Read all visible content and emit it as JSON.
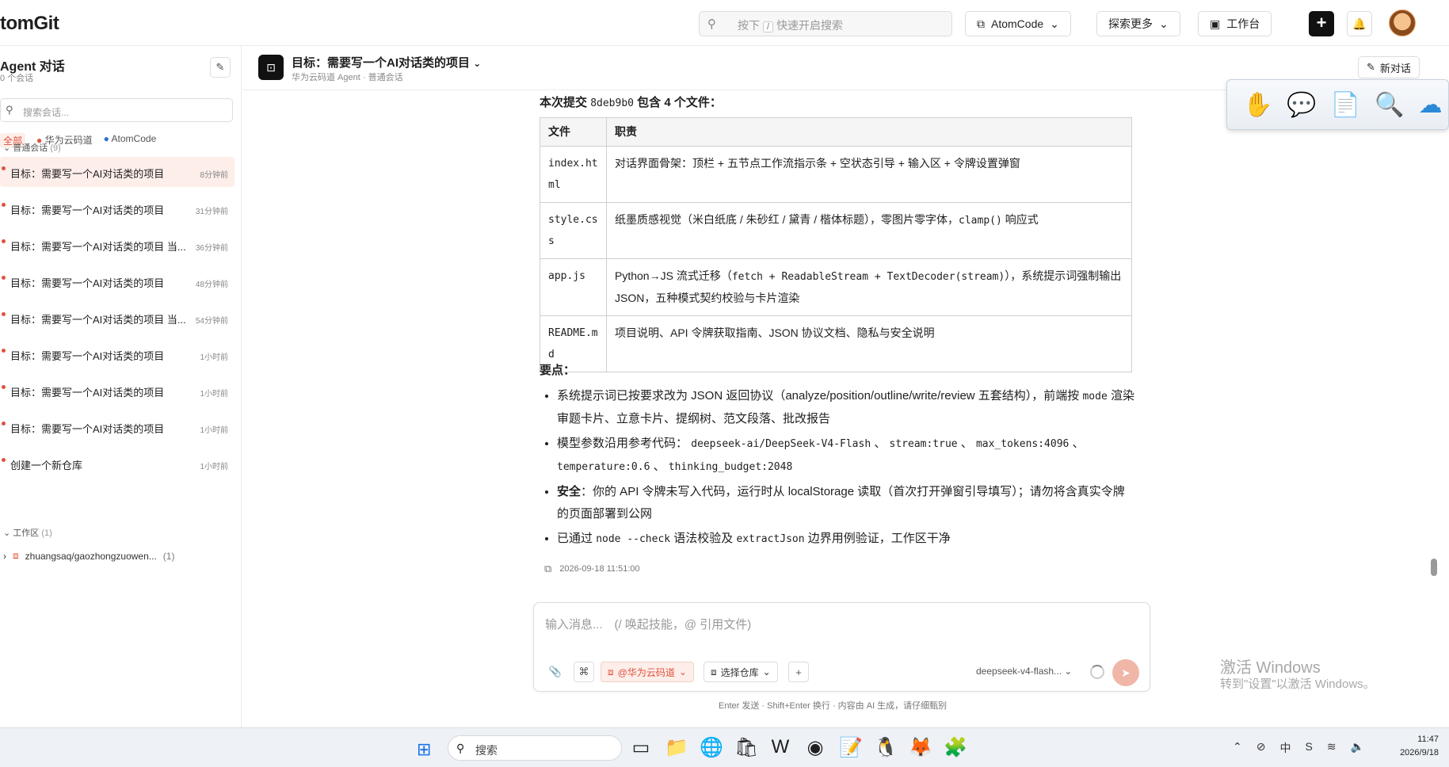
{
  "header": {
    "logo": "tomGit",
    "search_placeholder": "按下",
    "search_key": "/",
    "search_suffix": "快速开启搜索",
    "atomcode_label": "AtomCode",
    "explore_label": "探索更多",
    "workbench_label": "工作台"
  },
  "sidebar": {
    "title": "Agent 对话",
    "subtitle": "0 个会话",
    "search_placeholder": "搜索会话...",
    "filters": [
      "全部",
      "华为云码道",
      "AtomCode"
    ],
    "section_normal": "普通会话",
    "section_normal_count": "(9)",
    "conversations": [
      {
        "title": "目标：需要写一个AI对话类的项目",
        "time": "8分钟前"
      },
      {
        "title": "目标：需要写一个AI对话类的项目",
        "time": "31分钟前"
      },
      {
        "title": "目标：需要写一个AI对话类的项目 当...",
        "time": "36分钟前"
      },
      {
        "title": "目标：需要写一个AI对话类的项目",
        "time": "48分钟前"
      },
      {
        "title": "目标：需要写一个AI对话类的项目 当...",
        "time": "54分钟前"
      },
      {
        "title": "目标：需要写一个AI对话类的项目",
        "time": "1小时前"
      },
      {
        "title": "目标：需要写一个AI对话类的项目",
        "time": "1小时前"
      },
      {
        "title": "目标：需要写一个AI对话类的项目",
        "time": "1小时前"
      },
      {
        "title": "创建一个新仓库",
        "time": "1小时前"
      }
    ],
    "section_workspace": "工作区",
    "section_workspace_count": "(1)",
    "workspace_item": "zhuangsaq/gaozhongzuowen...",
    "workspace_count": "(1)"
  },
  "chat_header": {
    "title": "目标：需要写一个AI对话类的项目",
    "subtitle": "华为云码道 Agent · 普通会话",
    "new_chat": "新对话"
  },
  "message": {
    "commit_prefix": "本次提交",
    "commit_hash": "8deb9b0",
    "commit_suffix": "包含 4 个文件：",
    "table_headers": [
      "文件",
      "职责"
    ],
    "files": [
      {
        "name": "index.html",
        "desc": "对话界面骨架：顶栏 + 五节点工作流指示条 + 空状态引导 + 输入区 + 令牌设置弹窗"
      },
      {
        "name": "style.css",
        "desc_a": "纸墨质感视觉（米白纸底 / 朱砂红 / 黛青 / 楷体标题），零图片零字体，",
        "desc_code": "clamp()",
        "desc_b": "响应式"
      },
      {
        "name": "app.js",
        "desc_a": "Python→JS 流式迁移（",
        "desc_code": "fetch + ReadableStream + TextDecoder(stream)",
        "desc_b": "），系统提示词强制输出 JSON，五种模式契约校验与卡片渲染"
      },
      {
        "name": "README.md",
        "desc": "项目说明、API 令牌获取指南、JSON 协议文档、隐私与安全说明"
      }
    ],
    "key_points_title": "要点：",
    "kp1_a": "系统提示词已按要求改为 JSON 返回协议（analyze/position/outline/write/review 五套结构），前端按",
    "kp1_code": "mode",
    "kp1_b": "渲染审题卡片、立意卡片、提纲树、范文段落、批改报告",
    "kp2_a": "模型参数沿用参考代码：",
    "kp2_c1": "deepseek-ai/DeepSeek-V4-Flash",
    "kp2_c2": "stream:true",
    "kp2_c3": "max_tokens:4096",
    "kp2_c4": "temperature:0.6",
    "kp2_c5": "thinking_budget:2048",
    "kp3_bold": "安全",
    "kp3_text": "：你的 API 令牌未写入代码，运行时从 localStorage 读取（首次打开弹窗引导填写）；请勿将含真实令牌的页面部署到公网",
    "kp4_a": "已通过",
    "kp4_c1": "node --check",
    "kp4_b": "语法校验及",
    "kp4_c2": "extractJson",
    "kp4_c": "边界用例验证，工作区干净",
    "timestamp": "2026-09-18 11:51:00"
  },
  "input": {
    "placeholder": "输入消息...　(/ 唤起技能，@ 引用文件)",
    "tag_huawei": "@华为云码道",
    "repo_select": "选择仓库",
    "model": "deepseek-v4-flash...",
    "hint": "Enter 发送 · Shift+Enter 换行 · 内容由 AI 生成，请仔细甄别"
  },
  "watermark": {
    "line1": "激活 Windows",
    "line2": "转到\"设置\"以激活 Windows。"
  },
  "taskbar": {
    "search": "搜索",
    "time": "11:47",
    "date": "2026/9/18"
  }
}
